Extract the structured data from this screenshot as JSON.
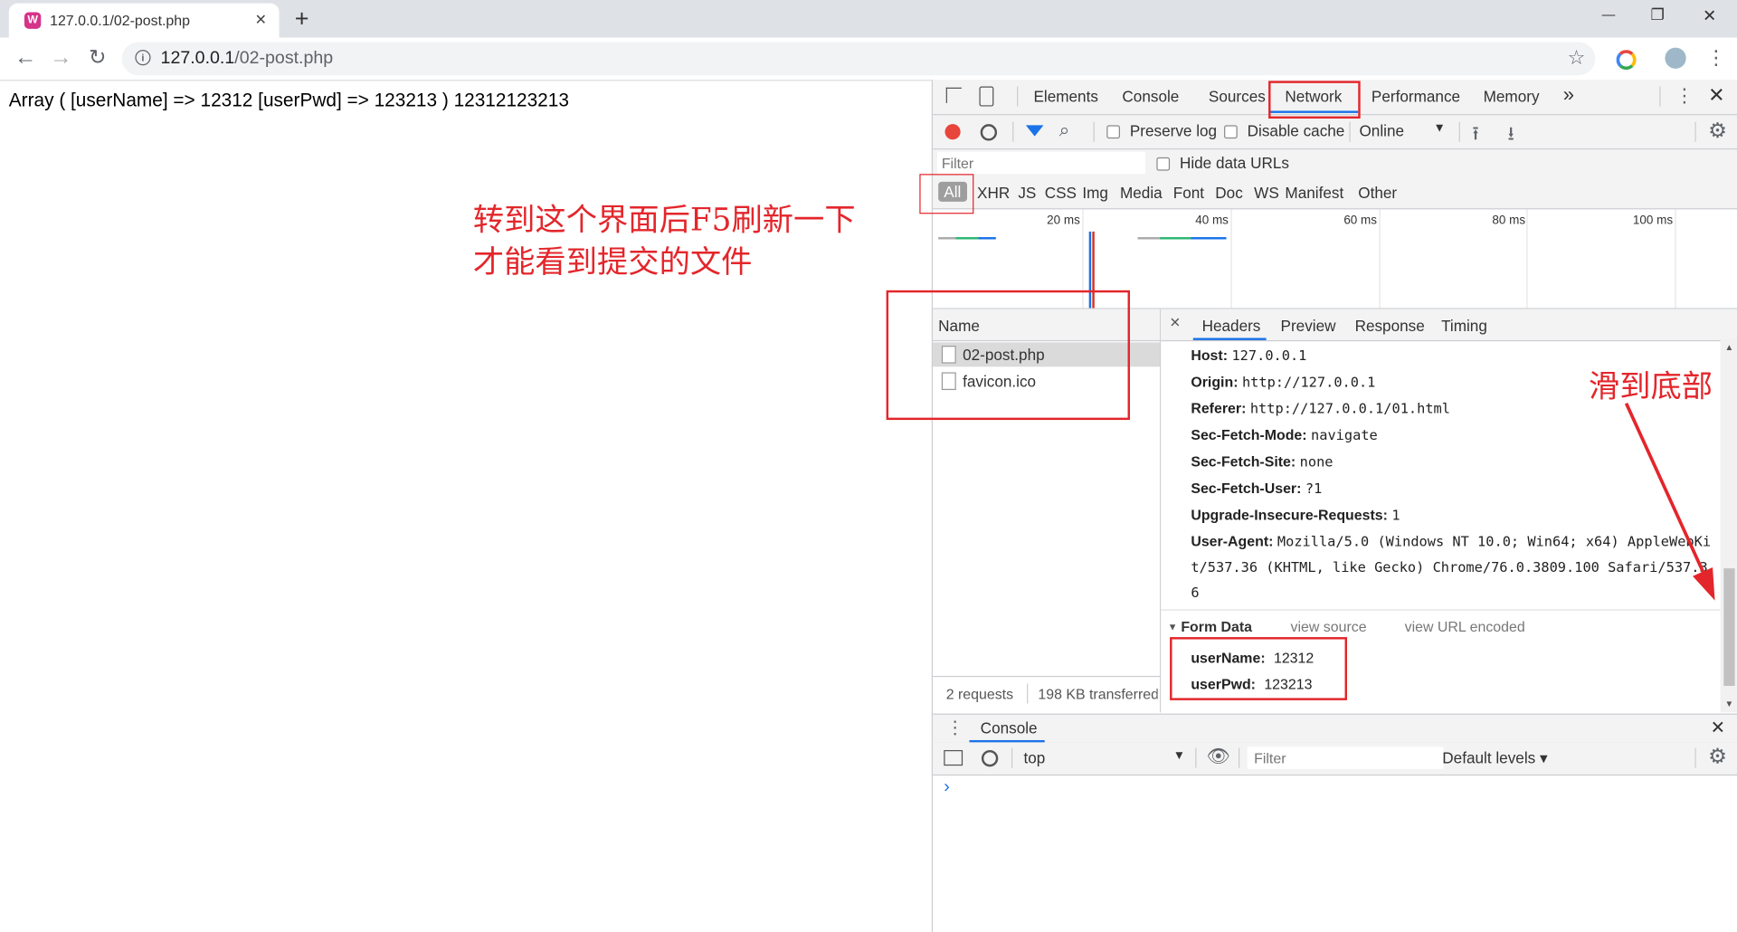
{
  "browser": {
    "tab_title": "127.0.0.1/02-post.php",
    "new_tab": "+",
    "tab_close": "✕",
    "url_host": "127.0.0.1",
    "url_path": "/02-post.php",
    "win_min": "—",
    "win_max": "❐",
    "win_close": "✕"
  },
  "page": {
    "output": "Array ( [userName] => 12312 [userPwd] => 123213 ) 12312123213"
  },
  "devtools": {
    "tabs": [
      "Elements",
      "Console",
      "Sources",
      "Network",
      "Performance",
      "Memory"
    ],
    "more": "»",
    "active_tab": "Network",
    "toolbar": {
      "preserve_log": "Preserve log",
      "disable_cache": "Disable cache",
      "throttle": "Online"
    },
    "filter_placeholder": "Filter",
    "hide_data_urls": "Hide data URLs",
    "types": [
      "All",
      "XHR",
      "JS",
      "CSS",
      "Img",
      "Media",
      "Font",
      "Doc",
      "WS",
      "Manifest",
      "Other"
    ],
    "timeline": [
      "20 ms",
      "40 ms",
      "60 ms",
      "80 ms",
      "100 ms"
    ],
    "name_header": "Name",
    "requests": [
      "02-post.php",
      "favicon.ico"
    ],
    "status_requests": "2 requests",
    "status_transferred": "198 KB transferred",
    "detail_tabs": [
      "Headers",
      "Preview",
      "Response",
      "Timing"
    ],
    "detail_close": "×",
    "headers": [
      {
        "k": "Host:",
        "v": "127.0.0.1"
      },
      {
        "k": "Origin:",
        "v": "http://127.0.0.1"
      },
      {
        "k": "Referer:",
        "v": "http://127.0.0.1/01.html"
      },
      {
        "k": "Sec-Fetch-Mode:",
        "v": "navigate"
      },
      {
        "k": "Sec-Fetch-Site:",
        "v": "none"
      },
      {
        "k": "Sec-Fetch-User:",
        "v": "?1"
      },
      {
        "k": "Upgrade-Insecure-Requests:",
        "v": "1"
      },
      {
        "k": "User-Agent:",
        "v": "Mozilla/5.0 (Windows NT 10.0; Win64; x64) AppleWebKi"
      }
    ],
    "ua_cont1": "t/537.36 (KHTML, like Gecko) Chrome/76.0.3809.100 Safari/537.3",
    "ua_cont2": "6",
    "form_data": {
      "title": "Form Data",
      "view_source": "view source",
      "view_url_encoded": "view URL encoded",
      "fields": [
        {
          "k": "userName:",
          "v": "12312"
        },
        {
          "k": "userPwd:",
          "v": "123213"
        }
      ]
    },
    "console": {
      "tab": "Console",
      "context": "top",
      "filter_placeholder": "Filter",
      "levels": "Default levels ▾",
      "prompt": "›"
    }
  },
  "annotations": {
    "note1_line1": "转到这个界面后F5刷新一下",
    "note1_line2": "才能看到提交的文件",
    "note2": "滑到底部"
  },
  "colors": {
    "annotation_red": "#e3262b",
    "record_red": "#e8453c",
    "active_blue": "#1a73e8"
  }
}
